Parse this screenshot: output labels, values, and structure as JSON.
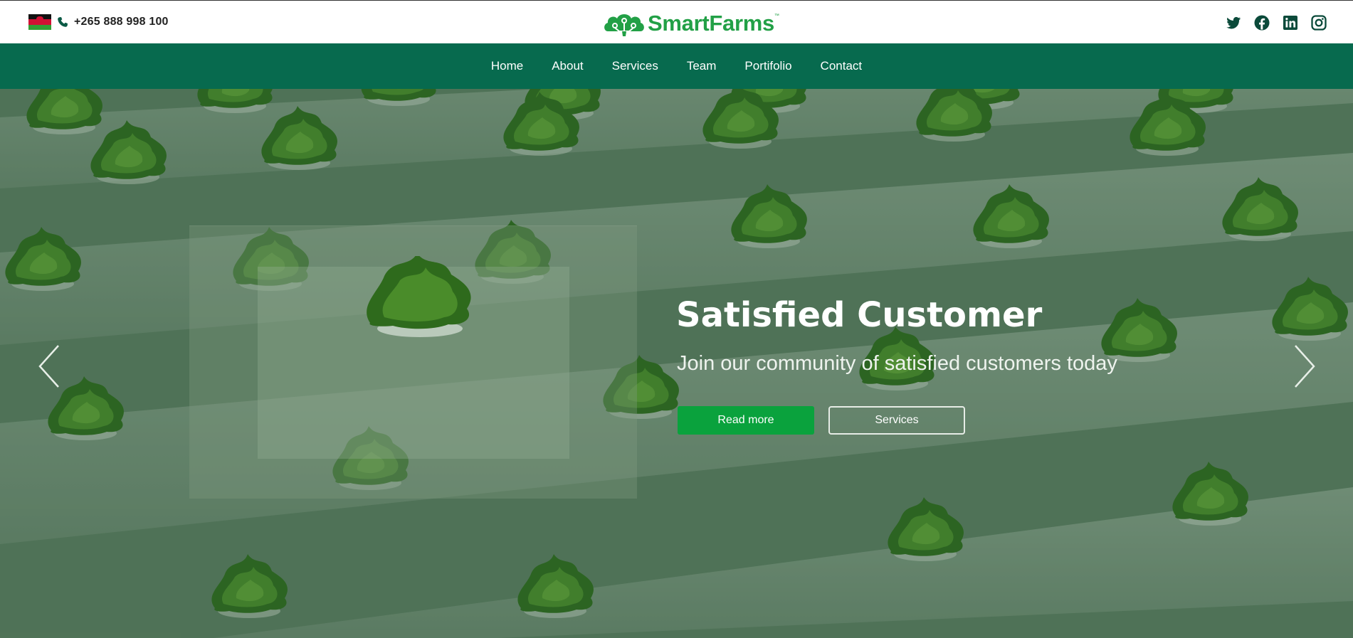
{
  "topbar": {
    "flag_icon": "malawi-flag-icon",
    "phone_icon": "phone-icon",
    "phone_number": "+265 888 998 100",
    "logo": {
      "text": "SmartFarms",
      "trademark": "™",
      "color": "#22a046"
    },
    "social_icons": [
      "twitter-icon",
      "facebook-icon",
      "linkedin-icon",
      "instagram-icon"
    ],
    "social_color": "#0b4a3a"
  },
  "nav": {
    "background": "#076a4e",
    "items": [
      "Home",
      "About",
      "Services",
      "Team",
      "Portifolio",
      "Contact"
    ]
  },
  "hero": {
    "title": "Satisfied Customer",
    "subtitle": "Join our community of satisfied customers today",
    "primary_button": "Read more",
    "secondary_button": "Services",
    "primary_color": "#0aa23d",
    "prev_icon": "chevron-left-icon",
    "next_icon": "chevron-right-icon"
  }
}
